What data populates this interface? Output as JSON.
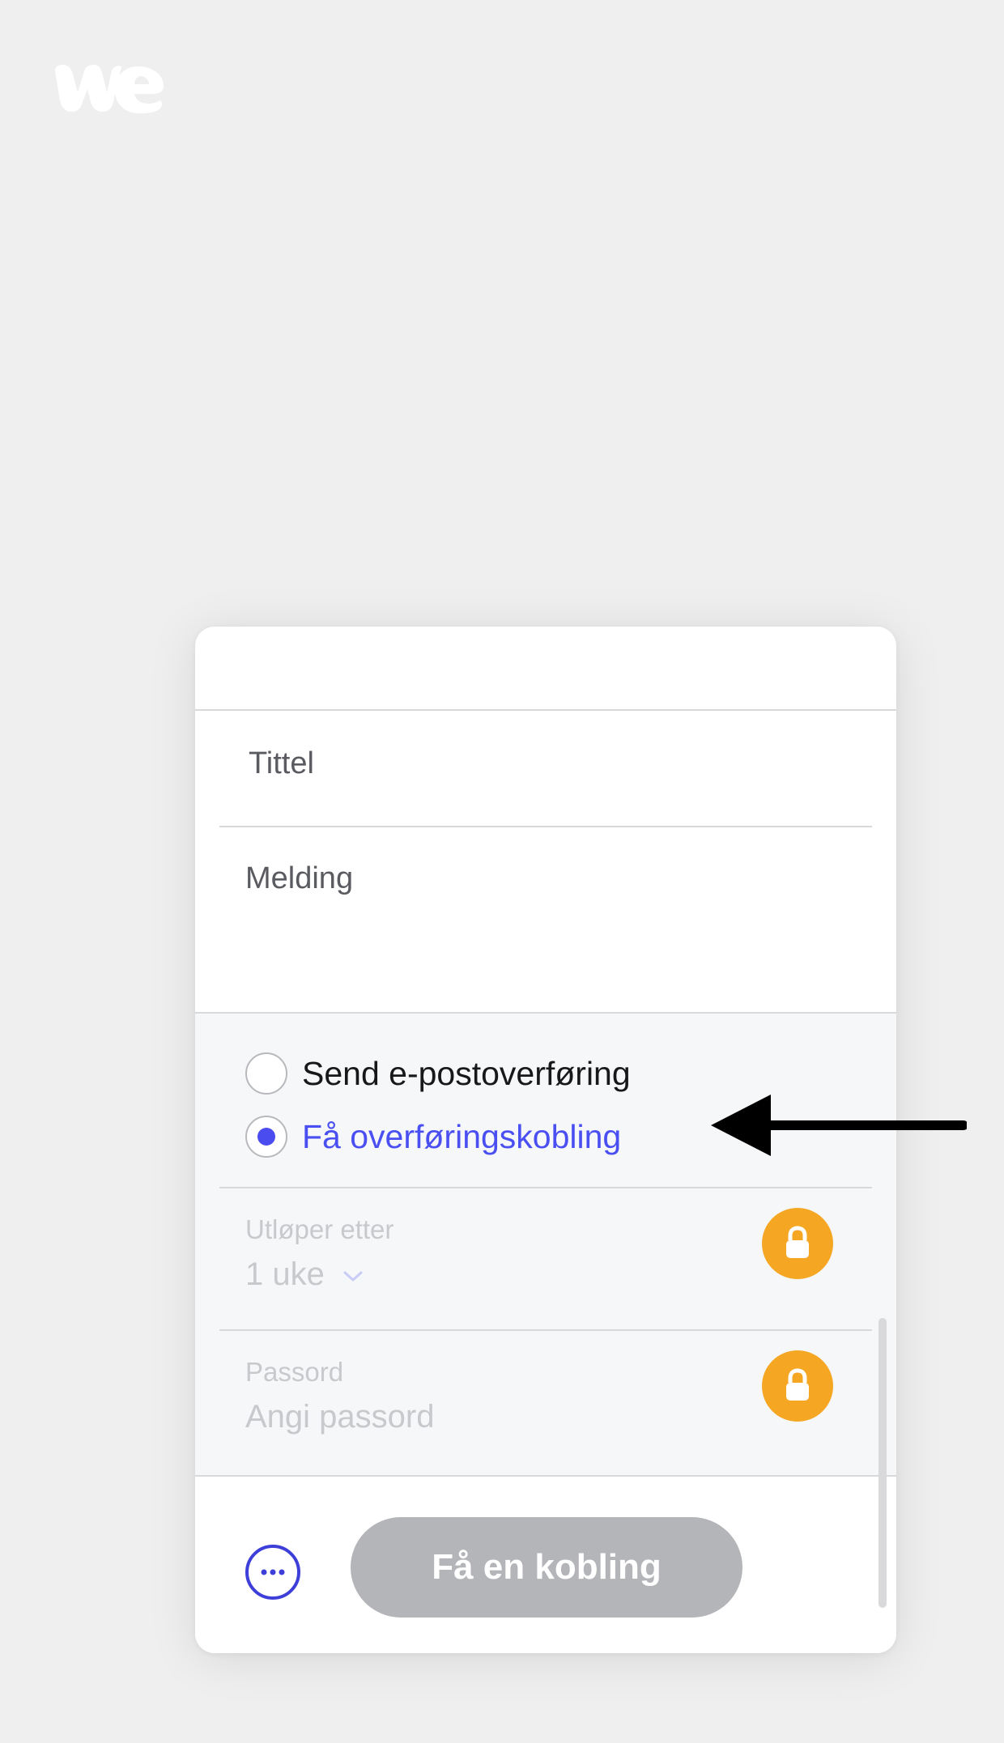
{
  "brand": {
    "logo_icon": "wetransfer-logo-icon"
  },
  "form": {
    "title_placeholder": "Tittel",
    "message_placeholder": "Melding"
  },
  "transfer_type": {
    "option_email": "Send e-postoverføring",
    "option_link": "Få overføringskobling",
    "selected": "option_link"
  },
  "settings": {
    "expiry_label": "Utløper etter",
    "expiry_value": "1 uke",
    "password_label": "Passord",
    "password_placeholder": "Angi passord",
    "lock_icon": "lock-icon"
  },
  "footer": {
    "more_icon": "more-options-icon",
    "primary_button": "Få en kobling"
  },
  "colors": {
    "accent": "#4a4ff2",
    "lock_badge": "#f5a623",
    "button_disabled": "#b4b5b8",
    "background": "#efefef"
  },
  "annotation": {
    "arrow_icon": "arrow-left-icon"
  }
}
